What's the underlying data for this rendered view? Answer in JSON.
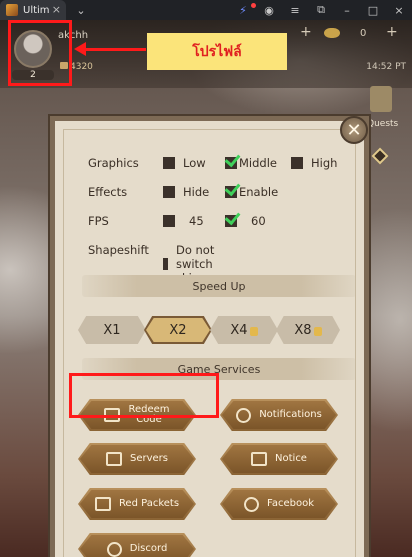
{
  "browser": {
    "tab_title": "Ultim",
    "tab_close": "×",
    "tab_menu": "⌄",
    "buttons": [
      "⚡",
      "◉",
      "≡",
      "⧉",
      "–",
      "□",
      "×"
    ]
  },
  "player": {
    "name": "akchh",
    "level": "2",
    "power": "4320",
    "time": "14:52 PT"
  },
  "resources": {
    "gold_count": "0",
    "plus": "+"
  },
  "sidebar": {
    "quests_label": "Quests"
  },
  "annotation": {
    "callout_text": "โปรไฟล์",
    "color": "#ff1a1a",
    "callout_bg": "#fbe47a"
  },
  "settings": {
    "close_label": "✕",
    "graphics": {
      "label": "Graphics",
      "low": "Low",
      "middle": "Middle",
      "high": "High",
      "selected": "Middle"
    },
    "effects": {
      "label": "Effects",
      "hide": "Hide",
      "enable": "Enable",
      "selected": "Enable"
    },
    "fps": {
      "label": "FPS",
      "opt45": "45",
      "opt60": "60",
      "selected": "60"
    },
    "shapeshift": {
      "label": "Shapeshift",
      "option": "Do not switch skin",
      "checked": false
    },
    "speed_up": {
      "title": "Speed Up",
      "options": [
        "X1",
        "X2",
        "X4",
        "X8"
      ],
      "selected": "X2",
      "locked": [
        "X4",
        "X8"
      ]
    },
    "game_services": {
      "title": "Game Services",
      "buttons": [
        {
          "label_line1": "Redeem",
          "label_line2": "Code",
          "icon": "gift-icon"
        },
        {
          "label": "Notifications",
          "icon": "bell-icon"
        },
        {
          "label": "Servers",
          "icon": "scroll-icon"
        },
        {
          "label": "Notice",
          "icon": "notice-board-icon"
        },
        {
          "label": "Red Packets",
          "icon": "envelope-icon"
        },
        {
          "label": "Facebook",
          "icon": "facebook-icon"
        },
        {
          "label": "Discord",
          "icon": "discord-icon"
        }
      ]
    }
  }
}
